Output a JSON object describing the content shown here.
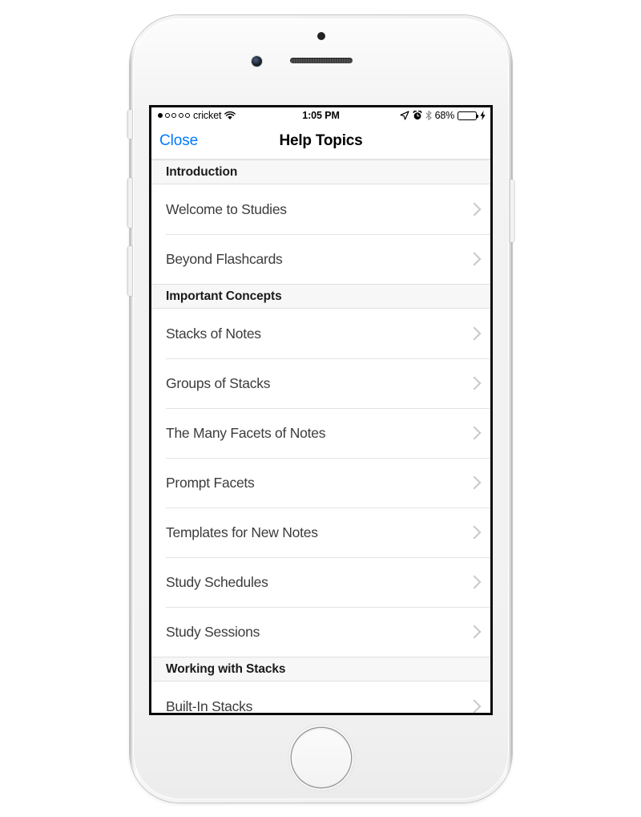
{
  "status_bar": {
    "signal_dots_filled": 1,
    "signal_dots_total": 5,
    "carrier": "cricket",
    "wifi_icon": "wifi-icon",
    "time": "1:05 PM",
    "location_icon": "location-arrow-icon",
    "alarm_icon": "alarm-clock-icon",
    "bluetooth_icon": "bluetooth-icon",
    "battery_percent": "68%",
    "battery_level": 68,
    "battery_color": "#4cd964",
    "charging_icon": "lightning-bolt-icon"
  },
  "nav_bar": {
    "close_label": "Close",
    "title": "Help Topics",
    "tint_color": "#007aff"
  },
  "sections": [
    {
      "header": "Introduction",
      "items": [
        {
          "label": "Welcome to Studies",
          "accessory": "chevron-right-icon"
        },
        {
          "label": "Beyond Flashcards",
          "accessory": "chevron-right-icon"
        }
      ]
    },
    {
      "header": "Important Concepts",
      "items": [
        {
          "label": "Stacks of Notes",
          "accessory": "chevron-right-icon"
        },
        {
          "label": "Groups of Stacks",
          "accessory": "chevron-right-icon"
        },
        {
          "label": "The Many Facets of Notes",
          "accessory": "chevron-right-icon"
        },
        {
          "label": "Prompt Facets",
          "accessory": "chevron-right-icon"
        },
        {
          "label": "Templates for New Notes",
          "accessory": "chevron-right-icon"
        },
        {
          "label": "Study Schedules",
          "accessory": "chevron-right-icon"
        },
        {
          "label": "Study Sessions",
          "accessory": "chevron-right-icon"
        }
      ]
    },
    {
      "header": "Working with Stacks",
      "items": [
        {
          "label": "Built-In Stacks",
          "accessory": "chevron-right-icon"
        }
      ]
    }
  ],
  "device": {
    "home_button": "home-button",
    "front_camera": "front-camera",
    "earpiece": "earpiece-speaker",
    "proximity_sensor": "proximity-sensor",
    "buttons": [
      "mute-switch",
      "volume-up-button",
      "volume-down-button",
      "power-button"
    ]
  }
}
